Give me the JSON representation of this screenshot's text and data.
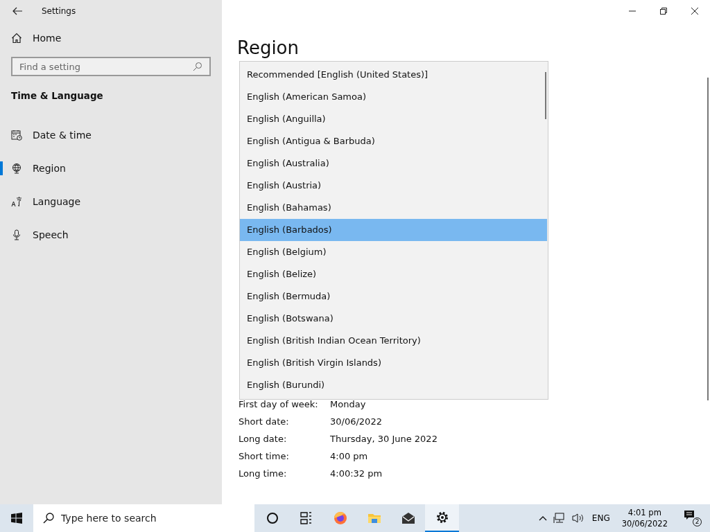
{
  "window": {
    "title": "Settings"
  },
  "sidebar": {
    "home": "Home",
    "search": {
      "placeholder": "Find a setting"
    },
    "section": "Time & Language",
    "items": [
      {
        "label": "Date & time",
        "kind": "calendar",
        "selected": false
      },
      {
        "label": "Region",
        "kind": "globe",
        "selected": true
      },
      {
        "label": "Language",
        "kind": "language",
        "selected": false
      },
      {
        "label": "Speech",
        "kind": "microphone",
        "selected": false
      }
    ]
  },
  "page": {
    "title": "Region"
  },
  "dropdown": {
    "options": [
      {
        "label": "Recommended [English (United States)]",
        "selected": false
      },
      {
        "label": "English (American Samoa)",
        "selected": false
      },
      {
        "label": "English (Anguilla)",
        "selected": false
      },
      {
        "label": "English (Antigua & Barbuda)",
        "selected": false
      },
      {
        "label": "English (Australia)",
        "selected": false
      },
      {
        "label": "English (Austria)",
        "selected": false
      },
      {
        "label": "English (Bahamas)",
        "selected": false
      },
      {
        "label": "English (Barbados)",
        "selected": true
      },
      {
        "label": "English (Belgium)",
        "selected": false
      },
      {
        "label": "English (Belize)",
        "selected": false
      },
      {
        "label": "English (Bermuda)",
        "selected": false
      },
      {
        "label": "English (Botswana)",
        "selected": false
      },
      {
        "label": "English (British Indian Ocean Territory)",
        "selected": false
      },
      {
        "label": "English (British Virgin Islands)",
        "selected": false
      },
      {
        "label": "English (Burundi)",
        "selected": false
      }
    ]
  },
  "details": [
    {
      "label": "First day of week:",
      "value": "Monday"
    },
    {
      "label": "Short date:",
      "value": "30/06/2022"
    },
    {
      "label": "Long date:",
      "value": "Thursday, 30 June 2022"
    },
    {
      "label": "Short time:",
      "value": "4:00 pm"
    },
    {
      "label": "Long time:",
      "value": "4:00:32 pm"
    }
  ],
  "taskbar": {
    "search": {
      "placeholder": "Type here to search"
    },
    "apps": [
      {
        "kind": "cortana",
        "active": false
      },
      {
        "kind": "taskview",
        "active": false
      },
      {
        "kind": "firefox",
        "active": false
      },
      {
        "kind": "folder",
        "active": false
      },
      {
        "kind": "mail",
        "active": false
      },
      {
        "kind": "settings",
        "active": true
      }
    ],
    "tray": {
      "language": "ENG",
      "time": "4:01 pm",
      "date": "30/06/2022",
      "notifications": "2"
    }
  }
}
